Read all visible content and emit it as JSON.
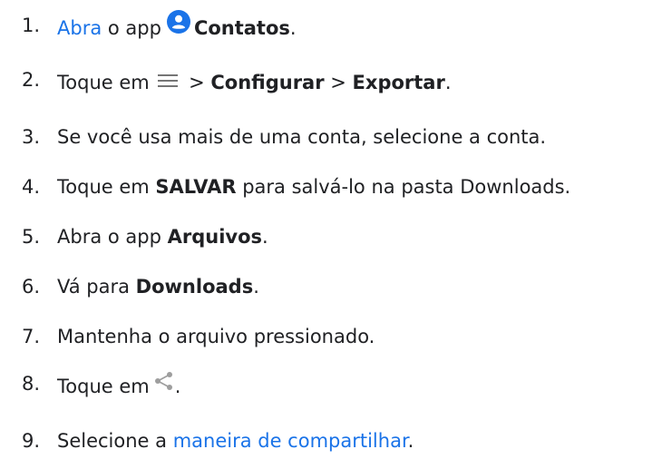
{
  "colors": {
    "link": "#1a73e8",
    "text": "#202124",
    "contacts_icon_bg": "#1a73e8",
    "menu_icon": "#757575",
    "share_icon": "#9e9e9e"
  },
  "steps": [
    {
      "number": "1.",
      "link_open": "Abra",
      "text_a": " o app",
      "icon": "contacts-icon",
      "bold_app": "Contatos",
      "end": "."
    },
    {
      "number": "2.",
      "text_a": "Toque em",
      "icon": "menu-icon",
      "sep_1": " > ",
      "bold_1": "Configurar",
      "sep_2": " > ",
      "bold_2": "Exportar",
      "end": "."
    },
    {
      "number": "3.",
      "text": "Se você usa mais de uma conta, selecione a conta."
    },
    {
      "number": "4.",
      "text_a": "Toque em ",
      "bold": "SALVAR",
      "text_b": " para salvá-lo na pasta Downloads."
    },
    {
      "number": "5.",
      "text_a": "Abra o app ",
      "bold": "Arquivos",
      "end": "."
    },
    {
      "number": "6.",
      "text_a": "Vá para ",
      "bold": "Downloads",
      "end": "."
    },
    {
      "number": "7.",
      "text": "Mantenha o arquivo pressionado."
    },
    {
      "number": "8.",
      "text_a": "Toque em",
      "icon": "share-icon",
      "end": "."
    },
    {
      "number": "9.",
      "text_a": "Selecione a ",
      "link": "maneira de compartilhar",
      "end": "."
    }
  ]
}
